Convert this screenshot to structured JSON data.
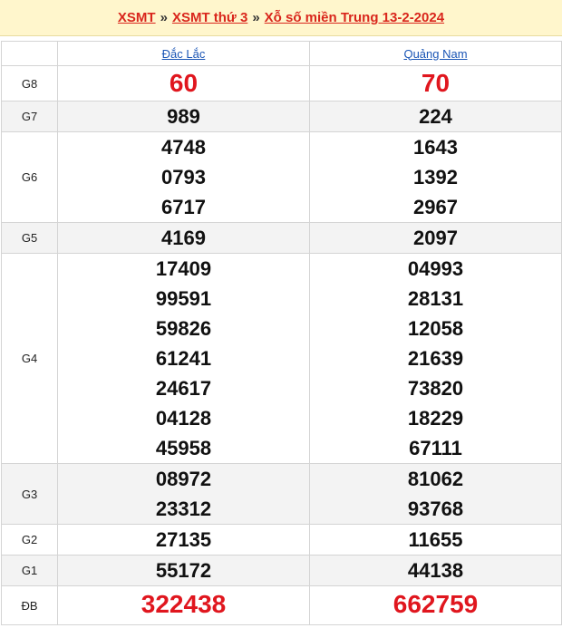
{
  "breadcrumb": {
    "item1": "XSMT",
    "item2": "XSMT thứ 3",
    "item3": "Xỗ số miền Trung 13-2-2024",
    "separator": "»"
  },
  "provinces": [
    "Đắc Lắc",
    "Quảng Nam"
  ],
  "prizes": [
    {
      "label": "G8",
      "values": [
        [
          "60"
        ],
        [
          "70"
        ]
      ]
    },
    {
      "label": "G7",
      "values": [
        [
          "989"
        ],
        [
          "224"
        ]
      ]
    },
    {
      "label": "G6",
      "values": [
        [
          "4748",
          "0793",
          "6717"
        ],
        [
          "1643",
          "1392",
          "2967"
        ]
      ]
    },
    {
      "label": "G5",
      "values": [
        [
          "4169"
        ],
        [
          "2097"
        ]
      ]
    },
    {
      "label": "G4",
      "values": [
        [
          "17409",
          "99591",
          "59826",
          "61241",
          "24617",
          "04128",
          "45958"
        ],
        [
          "04993",
          "28131",
          "12058",
          "21639",
          "73820",
          "18229",
          "67111"
        ]
      ]
    },
    {
      "label": "G3",
      "values": [
        [
          "08972",
          "23312"
        ],
        [
          "81062",
          "93768"
        ]
      ]
    },
    {
      "label": "G2",
      "values": [
        [
          "27135"
        ],
        [
          "11655"
        ]
      ]
    },
    {
      "label": "G1",
      "values": [
        [
          "55172"
        ],
        [
          "44138"
        ]
      ]
    },
    {
      "label": "ĐB",
      "values": [
        [
          "322438"
        ],
        [
          "662759"
        ]
      ]
    }
  ],
  "colors": {
    "accent_red": "#e0161e",
    "link_blue": "#1a55b5",
    "header_bg": "#fff6cc"
  }
}
